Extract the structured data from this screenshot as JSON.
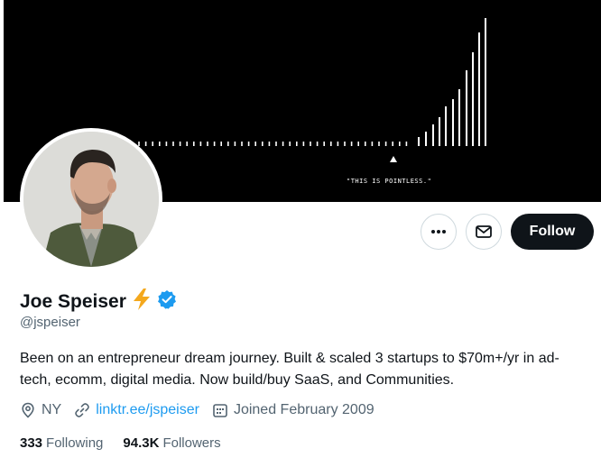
{
  "banner": {
    "caption": "\"THIS IS POINTLESS.\""
  },
  "profile": {
    "name": "Joe Speiser",
    "emoji": "⚡",
    "handle": "@jspeiser",
    "bio": "Been on an entrepreneur dream journey. Built & scaled 3 startups to $70m+/yr in ad-tech, ecomm, digital media. Now build/buy SaaS, and Communities.",
    "location": "NY",
    "link": "linktr.ee/jspeiser",
    "joined": "Joined February 2009"
  },
  "actions": {
    "more_icon": "more-dots-icon",
    "message_icon": "envelope-icon",
    "follow_label": "Follow"
  },
  "stats": {
    "following_count": "333",
    "following_label": "Following",
    "followers_count": "94.3K",
    "followers_label": "Followers"
  },
  "colors": {
    "verified": "#1d9bf0",
    "link": "#1d9bf0",
    "secondary_text": "#536471",
    "lightning": "#f4a81d"
  }
}
